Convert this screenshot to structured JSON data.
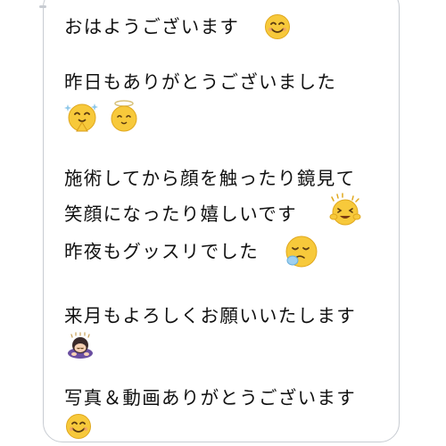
{
  "message": {
    "lines": [
      "おはようございます",
      "昨日もありがとうございました",
      "施術してから顔を触ったり鏡見て",
      "笑顔になったり嬉しいです",
      "昨夜もグッスリでした",
      "来月もよろしくお願いいたします",
      "写真＆動画ありがとうございます"
    ],
    "emoji": [
      "smiling-face-icon",
      "praying-smiling-face-icon",
      "smiling-face-icon",
      "happy-sparkle-face-icon",
      "sleeping-face-icon",
      "bowing-person-icon",
      "smiling-face-icon"
    ]
  },
  "colors": {
    "bubble_border": "#c8ccd2",
    "text": "#111111",
    "emoji_yellow": "#f7c93b"
  }
}
